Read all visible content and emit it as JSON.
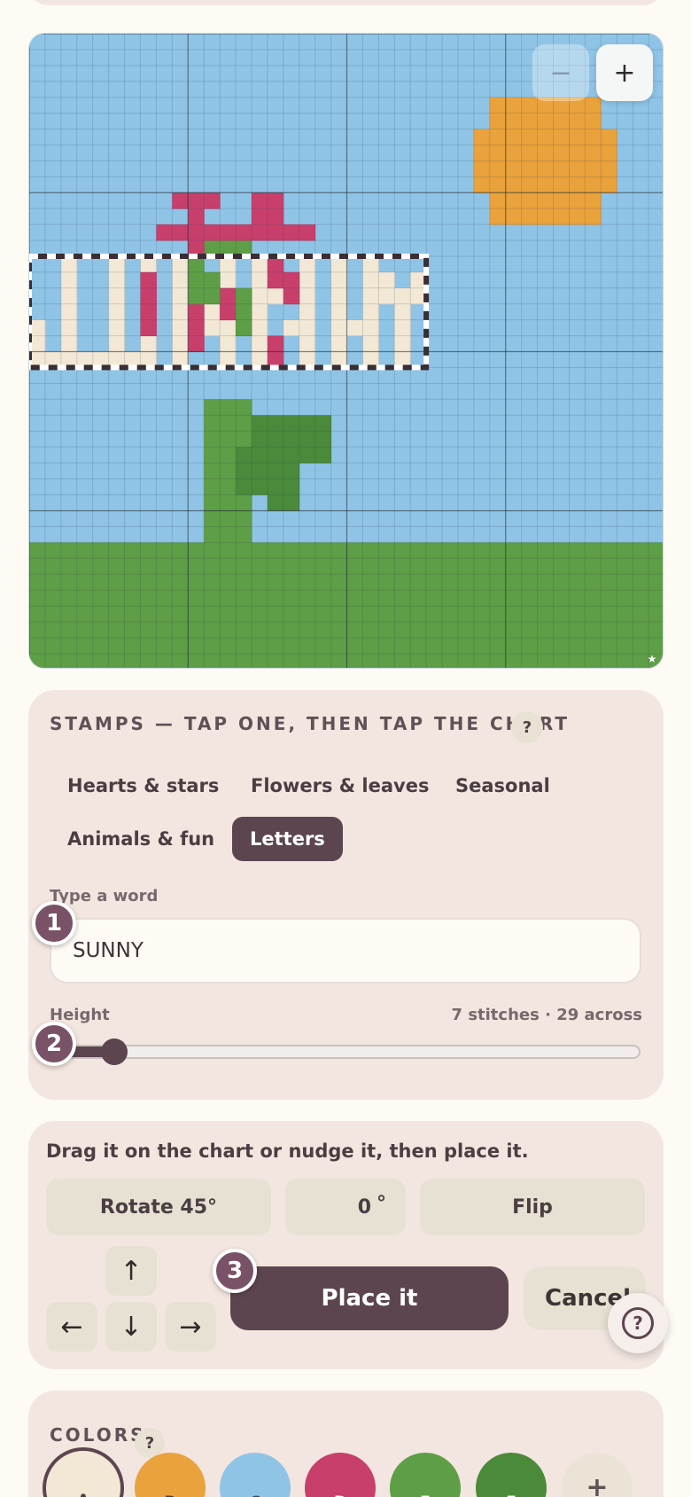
{
  "chart": {
    "zoom_out_label": "−",
    "zoom_in_label": "+",
    "corner_mark": "★",
    "colors": {
      "sky": "#8fc4e6",
      "grass": "#5e9e46",
      "stem": "#5e9e46",
      "leaf": "#4b8a3a",
      "sun": "#eaa23d",
      "flower": "#c83f6c",
      "letter": "#f3e8d6"
    }
  },
  "stamps": {
    "title": "STAMPS — TAP ONE, THEN TAP THE CHART",
    "help_label": "?",
    "categories": [
      {
        "label": "Hearts & stars",
        "active": false
      },
      {
        "label": "Flowers & leaves",
        "active": false
      },
      {
        "label": "Seasonal",
        "active": false
      },
      {
        "label": "Animals & fun",
        "active": false
      },
      {
        "label": "Letters",
        "active": true
      }
    ],
    "word_label": "Type a word",
    "word_value": "SUNNY",
    "height_label": "Height",
    "height_info": "7 stitches · 29 across",
    "height_fraction": 0.12,
    "step1": "1",
    "step2": "2"
  },
  "placement": {
    "hint": "Drag it on the chart or nudge it, then place it.",
    "rotate_label": "Rotate 45°",
    "angle_value": "0",
    "angle_unit": "°",
    "flip_label": "Flip",
    "up": "↑",
    "left": "←",
    "down": "↓",
    "right": "→",
    "step3": "3",
    "place_label": "Place it",
    "cancel_label": "Cancel",
    "help_label": "?"
  },
  "colors": {
    "title": "COLORS",
    "help_label": "?",
    "swatches": [
      {
        "letter": "A",
        "color": "#f3e8d6",
        "text": "#4a3e43",
        "selected": true
      },
      {
        "letter": "B",
        "color": "#eaa23d",
        "text": "#4a3e43",
        "selected": false
      },
      {
        "letter": "C",
        "color": "#8fc4e6",
        "text": "#3d4a5c",
        "selected": false
      },
      {
        "letter": "D",
        "color": "#c83f6c",
        "text": "#ffffff",
        "selected": false
      },
      {
        "letter": "E",
        "color": "#5e9e46",
        "text": "#ffffff",
        "selected": false
      },
      {
        "letter": "F",
        "color": "#4b8a3a",
        "text": "#ffffff",
        "selected": false
      }
    ],
    "add_label": "+"
  }
}
